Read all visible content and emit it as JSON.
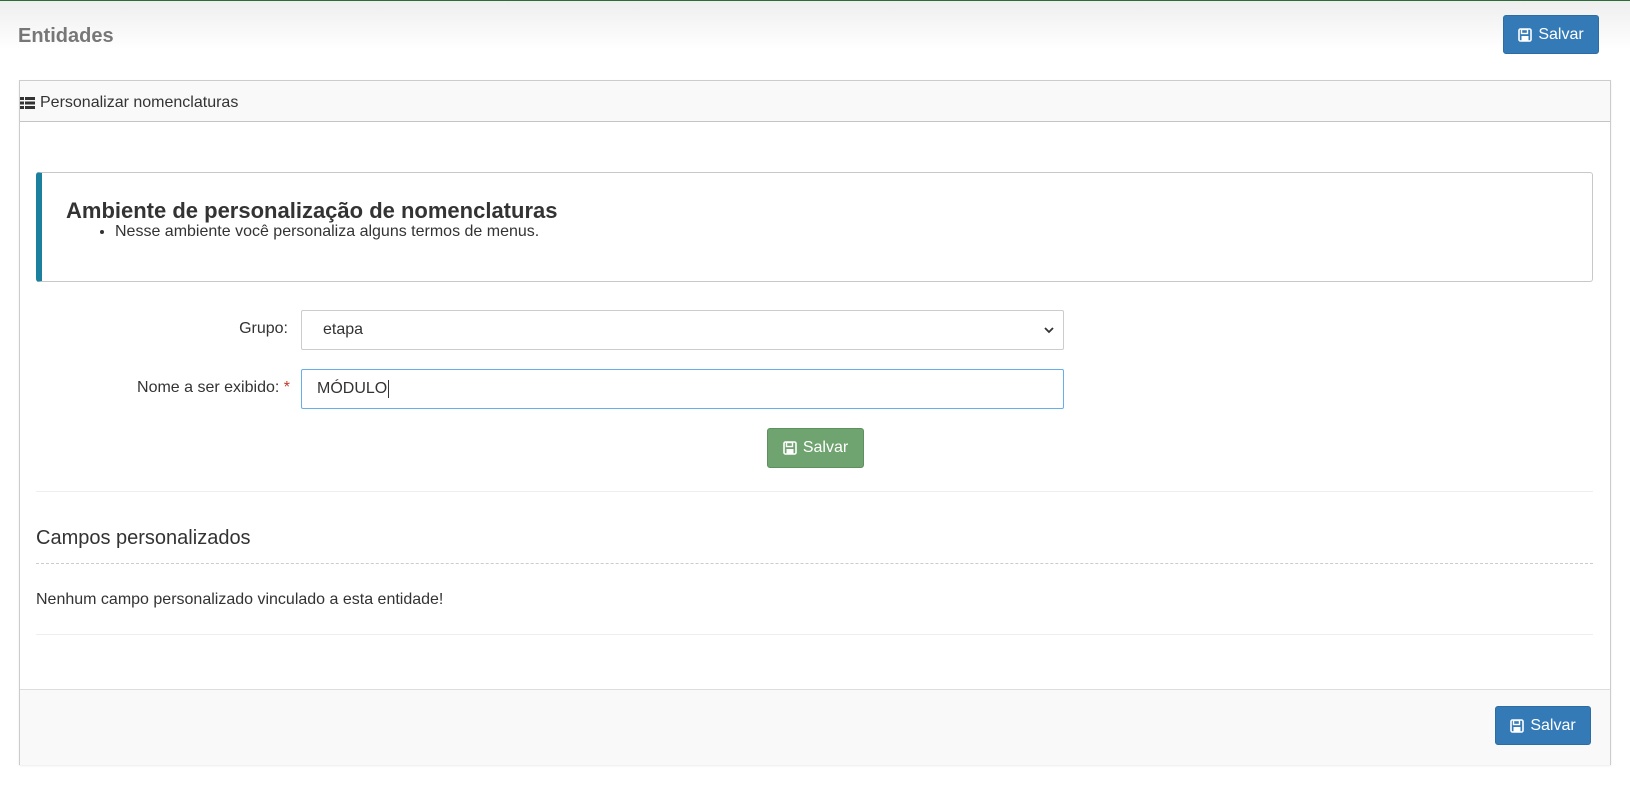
{
  "header": {
    "title": "Entidades",
    "save_label": "Salvar"
  },
  "panel": {
    "heading": "Personalizar nomenclaturas",
    "heading_icon": "list-icon",
    "callout": {
      "title": "Ambiente de personalização de nomenclaturas",
      "items": [
        "Nesse ambiente você personaliza alguns termos de menus."
      ]
    },
    "form": {
      "group_label": "Grupo:",
      "group_value": "etapa",
      "name_label": "Nome a ser exibido:",
      "required_mark": "*",
      "name_value": "MÓDULO",
      "save_label": "Salvar"
    },
    "custom_fields": {
      "title": "Campos personalizados",
      "empty_message": "Nenhum campo personalizado vinculado a esta entidade!"
    },
    "footer": {
      "save_label": "Salvar"
    }
  },
  "colors": {
    "primary": "#337ab7",
    "success": "#6fa36f",
    "callout_accent": "#1b809e",
    "required": "#c0392b"
  }
}
